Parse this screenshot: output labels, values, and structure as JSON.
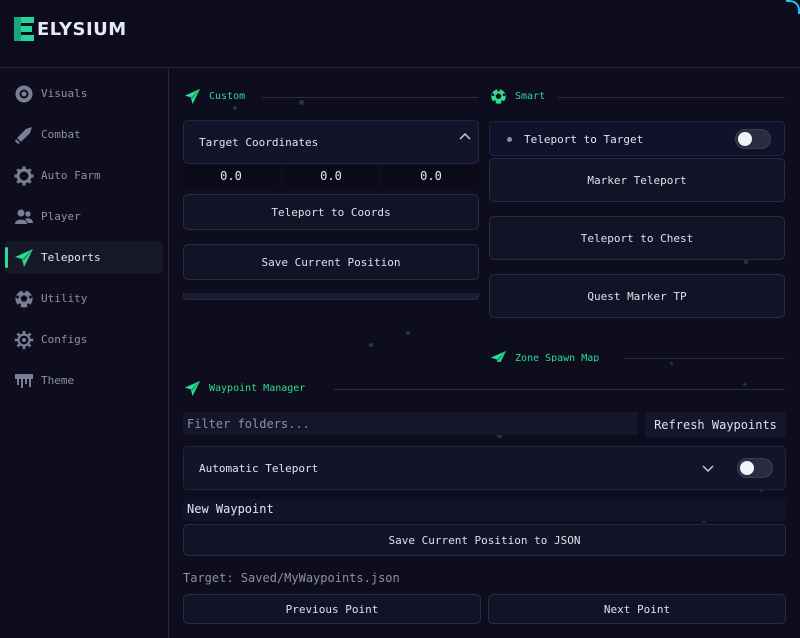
{
  "app": {
    "title": "ELYSIUM",
    "logo_letter": "E"
  },
  "colors": {
    "accent": "#2bdc92",
    "background": "#0d0d1e",
    "panel": "#13142a",
    "corner": "#1ec3ee"
  },
  "sidebar": {
    "items": [
      {
        "label": "Visuals",
        "icon": "eye-icon"
      },
      {
        "label": "Combat",
        "icon": "sword-icon"
      },
      {
        "label": "Auto Farm",
        "icon": "gear-icon"
      },
      {
        "label": "Player",
        "icon": "users-icon"
      },
      {
        "label": "Teleports",
        "icon": "paper-plane-icon",
        "active": true
      },
      {
        "label": "Utility",
        "icon": "soccer-ball-icon"
      },
      {
        "label": "Configs",
        "icon": "cog-icon"
      },
      {
        "label": "Theme",
        "icon": "paint-drip-icon"
      }
    ]
  },
  "custom": {
    "title": "Custom",
    "target_coordinates_label": "Target Coordinates",
    "coords": [
      "0.0",
      "0.0",
      "0.0"
    ],
    "teleport_coords_label": "Teleport to Coords",
    "save_position_label": "Save Current Position"
  },
  "smart": {
    "title": "Smart",
    "teleport_to_target_label": "Teleport to Target",
    "teleport_to_target_on": false,
    "marker_teleport_label": "Marker Teleport",
    "teleport_chest_label": "Teleport to Chest",
    "quest_marker_label": "Quest Marker TP"
  },
  "zone_spawn": {
    "title": "Zone Spawn Map"
  },
  "waypoints": {
    "title": "Waypoint Manager",
    "filter_placeholder": "Filter folders...",
    "refresh_label": "Refresh Waypoints",
    "auto_teleport_label": "Automatic Teleport",
    "auto_teleport_on": false,
    "new_waypoint_value": "New Waypoint",
    "save_json_label": "Save Current Position to JSON",
    "target_text": "Target: Saved/MyWaypoints.json",
    "previous_label": "Previous Point",
    "next_label": "Next Point"
  }
}
